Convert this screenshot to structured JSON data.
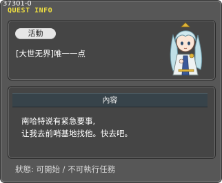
{
  "window": {
    "quest_id": "37301-0",
    "title": "QUEST INFO"
  },
  "quest": {
    "tag": "活動",
    "name": "[大世无界]唯一一点",
    "npc_icon": "npc-portrait-icon"
  },
  "content": {
    "header": "內容",
    "lines": [
      "南哈特说有紧急要事,",
      "让我去前哨基地找他。快去吧。"
    ]
  },
  "status": {
    "text": "狀態: 可開始 / 不可執行任務"
  },
  "colors": {
    "window_bg": "#575757",
    "panel_bg": "#454545",
    "title_accent": "#f0e040",
    "header_bar": "#37434a",
    "pill_bg": "#e6e6e6"
  }
}
